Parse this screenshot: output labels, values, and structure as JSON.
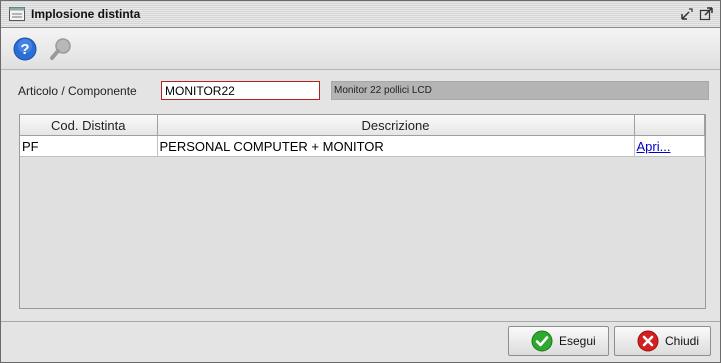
{
  "window": {
    "title": "Implosione distinta",
    "icon": "window-icon"
  },
  "toolbar": {
    "help_icon": "help-icon",
    "search_icon": "magnifier-icon"
  },
  "form": {
    "articolo_label": "Articolo / Componente",
    "articolo_value": "MONITOR22",
    "articolo_description": "Monitor 22 pollici LCD"
  },
  "table": {
    "columns": [
      "Cod. Distinta",
      "Descrizione",
      ""
    ],
    "rows": [
      {
        "cod": "PF",
        "descrizione": "PERSONAL COMPUTER + MONITOR",
        "link": "Apri..."
      }
    ]
  },
  "buttons": {
    "esegui": "Esegui",
    "chiudi": "Chiudi"
  },
  "colors": {
    "input_border": "#b22222",
    "ok_green": "#2fa82f",
    "close_red": "#d42020",
    "help_blue": "#2a6fd6",
    "link": "#0000cc"
  }
}
